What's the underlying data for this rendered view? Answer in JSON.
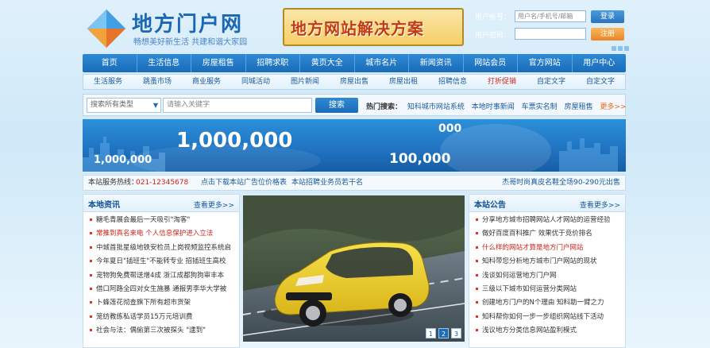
{
  "header": {
    "logo_title": "地方门户网",
    "logo_slogan": "畅想美好新生活    共建和谐大家园",
    "banner_ad": "地方网站解决方案"
  },
  "login": {
    "username_label": "用户帐号：",
    "username_placeholder": "用户名/手机号/邮箱",
    "password_label": "用户密码：",
    "login_button": "登录",
    "register_button": "注册"
  },
  "nav": {
    "items": [
      "首页",
      "生活信息",
      "房屋租售",
      "招聘求职",
      "黄页大全",
      "城市名片",
      "新闻资讯",
      "网站会员",
      "官方网站",
      "用户中心"
    ]
  },
  "subnav": {
    "items": [
      {
        "label": "生活服务",
        "red": false
      },
      {
        "label": "跳蚤市场",
        "red": false
      },
      {
        "label": "商业服务",
        "red": false
      },
      {
        "label": "同城活动",
        "red": false
      },
      {
        "label": "图片新闻",
        "red": false
      },
      {
        "label": "房屋出售",
        "red": false
      },
      {
        "label": "房屋出租",
        "red": false
      },
      {
        "label": "招聘信息",
        "red": false
      },
      {
        "label": "打折促销",
        "red": true
      },
      {
        "label": "自定文字",
        "red": false
      },
      {
        "label": "自定文字",
        "red": false
      }
    ]
  },
  "search": {
    "type_value": "搜索所有类型",
    "input_placeholder": "请输入关键字",
    "button": "搜索",
    "hot_label": "热门搜索：",
    "hot_links": [
      "知科城市网站系统",
      "本地时事新闻",
      "车票实名制",
      "房屋租售"
    ],
    "more": "更多>>"
  },
  "hero": {
    "big_number": "1,000,000",
    "left_number": "1,000,000",
    "mid_number": "100,000",
    "top_number": "000"
  },
  "service": {
    "label": "本站服务热线：",
    "phone": "021-12345678",
    "link1": "点击下载本站广告位价格表",
    "link2": "本站招聘业务员若干名",
    "right": "杰哥时尚真皮名鞋全场90-290元出售"
  },
  "local_news": {
    "title": "本地资讯",
    "more": "查看更多>>",
    "items": [
      {
        "text": "糖毛青展会最后一天吸引\"淘客\"",
        "red": false
      },
      {
        "text": "常推到真名来电 个人信息保护进入立法",
        "red": true
      },
      {
        "text": "中城首批星级地铁安检员上岗视频监控系统启",
        "red": false
      },
      {
        "text": "今年夏日\"插班生\"不能转专业 招插班生高校",
        "red": false
      },
      {
        "text": "宠物狗免费帮送增4成  浙江成都狗狗审丰本",
        "red": false
      },
      {
        "text": "借口阿路全四对女生施暴  通报男李华大学被",
        "red": false
      },
      {
        "text": "卜蜂莲花彻查旗下所有超市货架",
        "red": false
      },
      {
        "text": "笼纺教练私话学员15万元培训费",
        "red": false
      },
      {
        "text": "社会与法：偶偷第三次被探头 \"逮到\"",
        "red": false
      }
    ]
  },
  "photo": {
    "pages": [
      "1",
      "2",
      "3"
    ]
  },
  "notices": {
    "title": "本站公告",
    "more": "查看更多>>",
    "items": [
      {
        "text": "分享地方城市招聘网站人才网站的运营经验",
        "red": false
      },
      {
        "text": "做好百度百科推广 效果优于竞价排名",
        "red": false
      },
      {
        "text": "什么样的网站才算是地方门户网站",
        "red": true
      },
      {
        "text": "知科带您分析地方城市门户网站的现状",
        "red": false
      },
      {
        "text": "浅谈如何运营地方门户网",
        "red": false
      },
      {
        "text": "三级以下城市如何运营分类网站",
        "red": false
      },
      {
        "text": "创建地方门户的N个理由 知科助一臂之力",
        "red": false
      },
      {
        "text": "知科帮你如何一步一步组织网站线下活动",
        "red": false
      },
      {
        "text": "浅议地方分类信息网站盈利模式",
        "red": false
      }
    ]
  },
  "colors": {
    "primary": "#1a6bb8",
    "accent_red": "#d0211a",
    "accent_orange": "#e8842a"
  }
}
